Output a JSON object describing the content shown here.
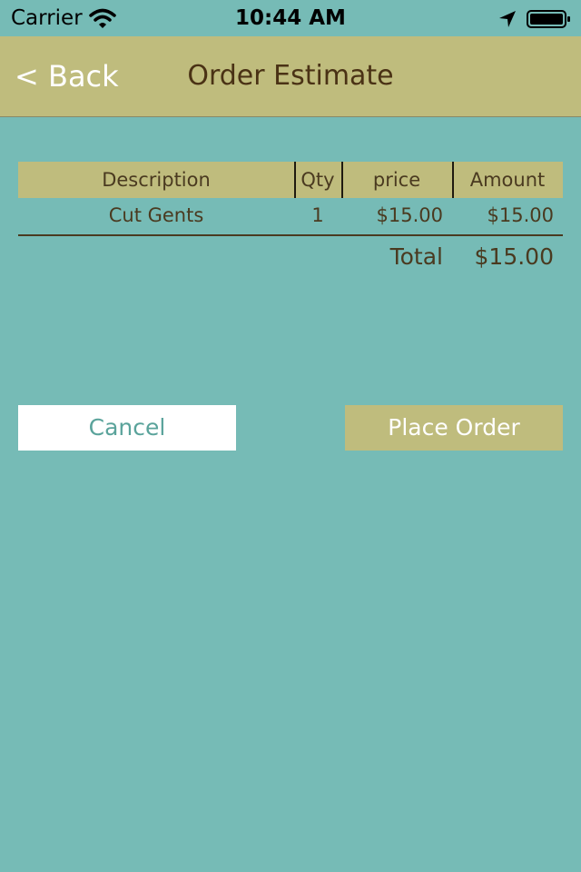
{
  "status_bar": {
    "carrier": "Carrier",
    "time": "10:44 AM",
    "icons": [
      "wifi-icon",
      "location-arrow-icon",
      "battery-icon"
    ]
  },
  "nav_bar": {
    "back_label": "< Back",
    "title": "Order Estimate"
  },
  "table": {
    "headers": {
      "description": "Description",
      "qty": "Qty",
      "price": "price",
      "amount": "Amount"
    },
    "rows": [
      {
        "description": "Cut Gents",
        "qty": "1",
        "price": "$15.00",
        "amount": "$15.00"
      }
    ],
    "total_label": "Total",
    "total_value": "$15.00"
  },
  "buttons": {
    "cancel": "Cancel",
    "place_order": "Place Order"
  },
  "colors": {
    "background": "#76bbb6",
    "accent": "#bfbc7d",
    "title_text": "#4a3215",
    "cancel_text": "#5aa39b"
  }
}
